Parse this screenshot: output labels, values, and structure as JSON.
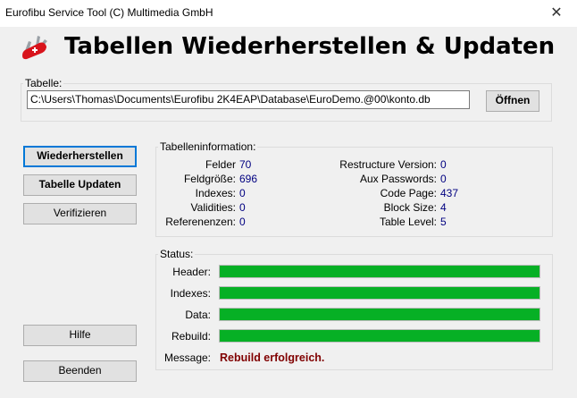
{
  "window": {
    "title": "Eurofibu Service Tool (C) Multimedia GmbH",
    "close_symbol": "✕"
  },
  "header": {
    "title": "Tabellen Wiederherstellen & Updaten",
    "icon": "swiss-knife-icon"
  },
  "tabelle": {
    "legend": "Tabelle:",
    "path": "C:\\Users\\Thomas\\Documents\\Eurofibu 2K4EAP\\Database\\EuroDemo.@00\\konto.db",
    "open_label": "Öffnen"
  },
  "buttons": {
    "restore": "Wiederherstellen",
    "update": "Tabelle Updaten",
    "verify": "Verifizieren",
    "help": "Hilfe",
    "exit": "Beenden"
  },
  "info": {
    "legend": "Tabelleninformation:",
    "left": [
      {
        "label": "Felder",
        "value": "70"
      },
      {
        "label": "Feldgröße:",
        "value": "696"
      },
      {
        "label": "Indexes:",
        "value": "0"
      },
      {
        "label": "Validities:",
        "value": "0"
      },
      {
        "label": "Referenenzen:",
        "value": "0"
      }
    ],
    "right": [
      {
        "label": "Restructure Version:",
        "value": "0"
      },
      {
        "label": "Aux Passwords:",
        "value": "0"
      },
      {
        "label": "Code Page:",
        "value": "437"
      },
      {
        "label": "Block Size:",
        "value": "4"
      },
      {
        "label": "Table Level:",
        "value": "5"
      }
    ]
  },
  "status": {
    "legend": "Status:",
    "rows": [
      {
        "label": "Header:",
        "progress": 1.0
      },
      {
        "label": "Indexes:",
        "progress": 1.0
      },
      {
        "label": "Data:",
        "progress": 1.0
      },
      {
        "label": "Rebuild:",
        "progress": 1.0
      }
    ],
    "message_label": "Message:",
    "message": "Rebuild erfolgreich."
  },
  "colors": {
    "progress": "#06b025",
    "message": "#800000",
    "value": "#000080",
    "focus": "#0078d7"
  }
}
